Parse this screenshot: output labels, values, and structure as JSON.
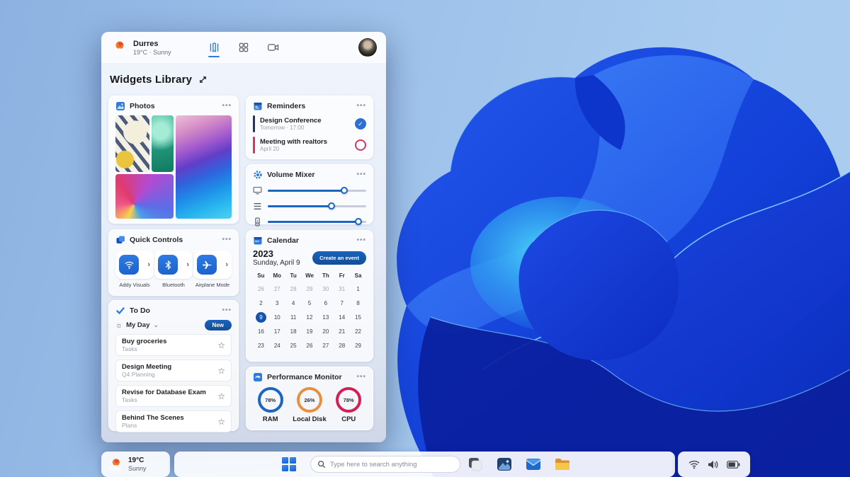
{
  "colors": {
    "accent_blue": "#1458b0",
    "slider_blue": "#1a66c2",
    "reminder_done_accent": "#25355c",
    "reminder_open_accent": "#cf3a5e",
    "ram_ring": "#1a66c2",
    "disk_ring": "#e59140",
    "cpu_ring": "#d41f55"
  },
  "icons": {
    "menu": "···",
    "star": "☆",
    "check": "✓",
    "chevron_right": "›",
    "chevron_down": "⌄",
    "sun": "☼",
    "expand": "⤢"
  },
  "header": {
    "location": "Durres",
    "weather_summary": "19°C · Sunny",
    "nav_icons": [
      "library",
      "widgets-grid",
      "video"
    ]
  },
  "page_title": {
    "text": "Widgets Library"
  },
  "photos": {
    "title": "Photos"
  },
  "reminders": {
    "title": "Reminders",
    "items": [
      {
        "title": "Design Conference",
        "subtitle": "Tomorrow · 17:00",
        "status": "done",
        "accent": "#25355c"
      },
      {
        "title": "Meeting with realtors",
        "subtitle": "April 20",
        "status": "open",
        "accent": "#cf3a5e"
      }
    ]
  },
  "volume_mixer": {
    "title": "Volume Mixer",
    "sliders": [
      {
        "device": "display",
        "value": 78
      },
      {
        "device": "app-list",
        "value": 65
      },
      {
        "device": "media-device",
        "value": 92
      }
    ]
  },
  "quick_controls": {
    "title": "Quick Controls",
    "controls": [
      {
        "label": "Addy Visuals",
        "icon": "wifi"
      },
      {
        "label": "Bluetooth",
        "icon": "bluetooth"
      },
      {
        "label": "Airplane Mode",
        "icon": "airplane"
      }
    ]
  },
  "calendar": {
    "title": "Calendar",
    "year": "2023",
    "full_date": "Sunday, April 9",
    "create_button": "Create an event",
    "day_headers": [
      "Su",
      "Mo",
      "Tu",
      "We",
      "Th",
      "Fr",
      "Sa"
    ],
    "days": [
      {
        "label": "26",
        "muted": true
      },
      {
        "label": "27",
        "muted": true
      },
      {
        "label": "28",
        "muted": true
      },
      {
        "label": "29",
        "muted": true
      },
      {
        "label": "30",
        "muted": true
      },
      {
        "label": "31",
        "muted": true
      },
      {
        "label": "1"
      },
      {
        "label": "2"
      },
      {
        "label": "3"
      },
      {
        "label": "4"
      },
      {
        "label": "5"
      },
      {
        "label": "6"
      },
      {
        "label": "7"
      },
      {
        "label": "8"
      },
      {
        "label": "9",
        "selected": true
      },
      {
        "label": "10"
      },
      {
        "label": "11"
      },
      {
        "label": "12"
      },
      {
        "label": "13"
      },
      {
        "label": "14"
      },
      {
        "label": "15"
      },
      {
        "label": "16"
      },
      {
        "label": "17"
      },
      {
        "label": "18"
      },
      {
        "label": "19"
      },
      {
        "label": "20"
      },
      {
        "label": "21"
      },
      {
        "label": "22"
      },
      {
        "label": "23"
      },
      {
        "label": "24"
      },
      {
        "label": "25"
      },
      {
        "label": "26"
      },
      {
        "label": "27"
      },
      {
        "label": "28"
      },
      {
        "label": "29"
      }
    ]
  },
  "todo": {
    "title": "To Do",
    "list_selector": "My Day",
    "new_button": "New",
    "tasks": [
      {
        "title": "Buy groceries",
        "list": "Tasks"
      },
      {
        "title": "Design Meeting",
        "list": "Q4 Planning"
      },
      {
        "title": "Revise for Database Exam",
        "list": "Tasks"
      },
      {
        "title": "Behind The Scenes",
        "list": "Plans"
      }
    ]
  },
  "performance": {
    "title": "Performance Monitor",
    "metrics": [
      {
        "label": "RAM",
        "value_label": "78%",
        "value": 78,
        "color": "#1a66c2"
      },
      {
        "label": "Local Disk",
        "value_label": "26%",
        "value": 26,
        "color": "#e59140"
      },
      {
        "label": "CPU",
        "value_label": "78%",
        "value": 78,
        "color": "#d41f55"
      }
    ]
  },
  "taskbar": {
    "weather_temp": "19°C",
    "weather_condition": "Sunny",
    "search_placeholder": "Type here to search anything",
    "app_icons": [
      "task-view",
      "photos-app",
      "mail-app",
      "file-explorer"
    ],
    "tray_icons": [
      "wifi",
      "volume",
      "battery"
    ]
  }
}
